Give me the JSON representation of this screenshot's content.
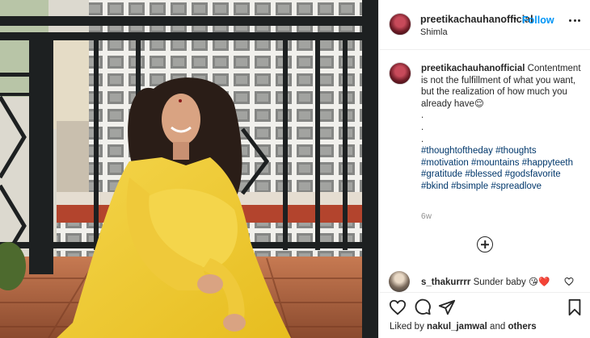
{
  "post": {
    "username": "preetikachauhanofficial",
    "separator": "•",
    "follow_label": "Follow",
    "location": "Shimla"
  },
  "caption": {
    "username": "preetikachauhanofficial",
    "text": "Contentment is not the fulfillment of what you want, but the realization of how much you already have😌",
    "dots": [
      ".",
      ".",
      "."
    ],
    "hashtags": [
      "#thoughtoftheday",
      "#thoughts",
      "#motivation",
      "#mountains",
      "#happyteeth",
      "#gratitude",
      "#blessed",
      "#godsfavorite",
      "#bkind",
      "#bsimple",
      "#spreadlove"
    ],
    "age": "6w"
  },
  "comment": {
    "username": "s_thakurrrr",
    "text": "Sunder baby 😘❤️"
  },
  "likes": {
    "prefix": "Liked by",
    "user": "nakul_jamwal",
    "and": "and",
    "others": "others"
  },
  "icons": {
    "more": "more-options-icon",
    "load_more": "load-more-comments-icon",
    "comment_like": "heart-outline-icon",
    "like": "heart-icon",
    "comment": "comment-bubble-icon",
    "share": "paper-plane-icon",
    "save": "bookmark-icon"
  },
  "colors": {
    "follow_blue": "#0095f6",
    "hashtag_blue": "#00376b",
    "text": "#262626",
    "muted": "#8e8e8e",
    "dress_yellow": "#f2cf3a"
  }
}
